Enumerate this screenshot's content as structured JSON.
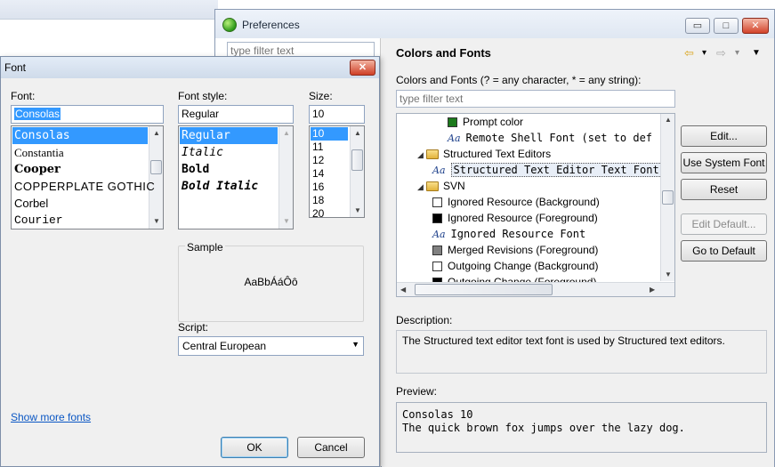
{
  "preferences": {
    "title": "Preferences",
    "filter_placeholder": "type filter text",
    "caption": {
      "minimize": "▭",
      "maximize": "□",
      "close": "✕"
    },
    "page_title": "Colors and Fonts",
    "nav": {
      "back": "⇦",
      "back_menu": "▾",
      "forward": "⇨",
      "forward_menu": "▾",
      "view_menu": "▼"
    },
    "colors_fonts_label": "Colors and Fonts (? = any character, * = any string):",
    "tree_filter_placeholder": "type filter text",
    "tree": [
      {
        "kind": "color",
        "swatch": "#1c7a1c",
        "label": "Prompt color",
        "indent": 3
      },
      {
        "kind": "font",
        "icon": "Aa",
        "label": "Remote Shell Font  (set to def",
        "indent": 3
      },
      {
        "kind": "category",
        "twisty": "◢",
        "label": "Structured Text Editors",
        "indent": 1
      },
      {
        "kind": "font",
        "icon": "Aa",
        "label": "Structured Text Editor Text Font",
        "indent": 2,
        "selected": true
      },
      {
        "kind": "category",
        "twisty": "◢",
        "label": "SVN",
        "indent": 1
      },
      {
        "kind": "color",
        "swatch": "#ffffff",
        "label": "Ignored Resource (Background)",
        "indent": 2
      },
      {
        "kind": "color",
        "swatch": "#000000",
        "label": "Ignored Resource (Foreground)",
        "indent": 2
      },
      {
        "kind": "font",
        "icon": "Aa",
        "label": "Ignored Resource Font",
        "indent": 2
      },
      {
        "kind": "color",
        "swatch": "#808080",
        "label": "Merged Revisions (Foreground)",
        "indent": 2
      },
      {
        "kind": "color",
        "swatch": "#ffffff",
        "label": "Outgoing Change (Background)",
        "indent": 2
      },
      {
        "kind": "color",
        "swatch": "#000000",
        "label": "Outgoing Change (Foreground)",
        "indent": 2
      }
    ],
    "buttons": {
      "edit": "Edit...",
      "use_system_font": "Use System Font",
      "reset": "Reset",
      "edit_default": "Edit Default...",
      "go_to_default": "Go to Default"
    },
    "description_label": "Description:",
    "description_text": "The Structured text editor text font is used by Structured text editors.",
    "preview_label": "Preview:",
    "preview_line1": "Consolas 10",
    "preview_line2": "The quick brown fox jumps over the lazy dog."
  },
  "font_dialog": {
    "title": "Font",
    "close": "✕",
    "font_label": "Font:",
    "font_value": "Consolas",
    "fonts": [
      "Consolas",
      "Constantia",
      "Cooper",
      "COPPERPLATE GOTHIC",
      "Corbel",
      "Courier"
    ],
    "style_label": "Font style:",
    "style_value": "Regular",
    "styles": [
      "Regular",
      "Italic",
      "Bold",
      "Bold Italic"
    ],
    "size_label": "Size:",
    "size_value": "10",
    "sizes": [
      "10",
      "11",
      "12",
      "14",
      "16",
      "18",
      "20"
    ],
    "sample_label": "Sample",
    "sample_text": "AaBbÁáÔô",
    "script_label": "Script:",
    "script_value": "Central European",
    "show_more_fonts": "Show more fonts",
    "ok": "OK",
    "cancel": "Cancel"
  }
}
